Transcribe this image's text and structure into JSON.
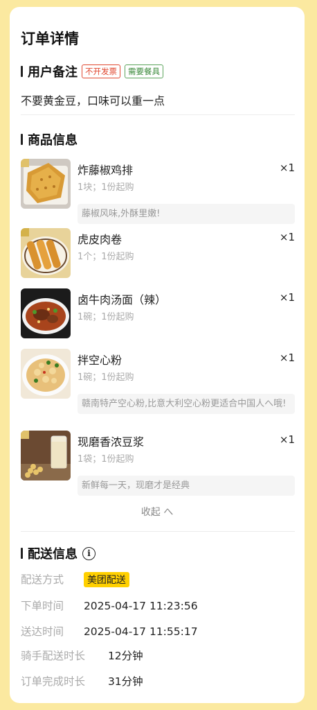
{
  "page_title": "订单详情",
  "remark_section": {
    "title": "用户备注",
    "tags": [
      "不开发票",
      "需要餐具"
    ],
    "text": "不要黄金豆，口味可以重一点"
  },
  "goods_section": {
    "title": "商品信息",
    "items": [
      {
        "name": "炸藤椒鸡排",
        "qty": "×1",
        "unit": "1块；1份起购",
        "desc": "藤椒风味,外酥里嫩!",
        "image": "fried-chicken-cutlet"
      },
      {
        "name": "虎皮肉卷",
        "qty": "×1",
        "unit": "1个；1份起购",
        "desc": "",
        "image": "meat-rolls"
      },
      {
        "name": "卤牛肉汤面（辣）",
        "qty": "×1",
        "unit": "1碗；1份起购",
        "desc": "",
        "image": "beef-noodle-soup"
      },
      {
        "name": "拌空心粉",
        "qty": "×1",
        "unit": "1碗；1份起购",
        "desc": "赣南特产空心粉,比意大利空心粉更适合中国人へ哦!",
        "image": "mixed-rice-noodles"
      },
      {
        "name": "现磨香浓豆浆",
        "qty": "×1",
        "unit": "1袋；1份起购",
        "desc": "新鲜每一天，现磨才是经典",
        "image": "soy-milk"
      }
    ],
    "collapse_label": "收起 へ"
  },
  "delivery_section": {
    "title": "配送信息",
    "info_icon": "info-icon",
    "rows": [
      {
        "label": "配送方式",
        "value": "美团配送"
      },
      {
        "label": "下单时间",
        "value": "2025-04-17 11:23:56"
      },
      {
        "label": "送达时间",
        "value": "2025-04-17 11:55:17"
      },
      {
        "label": "骑手配送时长",
        "value": "12分钟"
      },
      {
        "label": "订单完成时长",
        "value": "31分钟"
      }
    ]
  },
  "colors": {
    "background": "#fbe9a0",
    "badge": "#ffd000",
    "tag_red": "#e0472f",
    "tag_green": "#3b8a3b"
  }
}
